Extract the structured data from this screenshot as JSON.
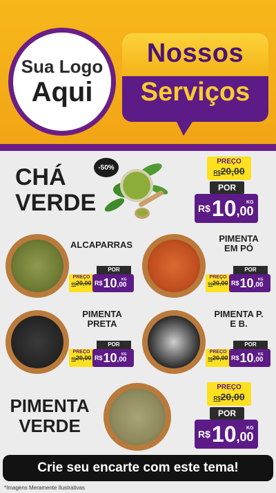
{
  "header": {
    "logo_line1": "Sua Logo",
    "logo_line2": "Aqui",
    "title_line1": "Nossos",
    "title_line2": "Serviços"
  },
  "featured": [
    {
      "name_line1": "CHÁ",
      "name_line2": "VERDE",
      "discount_badge": "-50%",
      "old_label": "PREÇO",
      "old_currency": "R$",
      "old_price": "20,00",
      "por_label": "POR",
      "currency": "R$",
      "price_int": "10",
      "price_dec": ",00",
      "unit": "KG"
    },
    {
      "name_line1": "PIMENTA",
      "name_line2": "VERDE",
      "old_label": "PREÇO",
      "old_currency": "R$",
      "old_price": "20,00",
      "por_label": "POR",
      "currency": "R$",
      "price_int": "10",
      "price_dec": ",00",
      "unit": "KG"
    }
  ],
  "products": [
    {
      "name_line1": "ALCAPARRAS",
      "name_line2": "",
      "old_label": "PREÇO",
      "old_currency": "R$",
      "old_price": "20,00",
      "por_label": "POR",
      "currency": "R$",
      "price_int": "10",
      "price_dec": ",00",
      "unit": "KG"
    },
    {
      "name_line1": "PIMENTA",
      "name_line2": "EM PÓ",
      "old_label": "PREÇO",
      "old_currency": "R$",
      "old_price": "20,00",
      "por_label": "POR",
      "currency": "R$",
      "price_int": "10",
      "price_dec": ",00",
      "unit": "KG"
    },
    {
      "name_line1": "PIMENTA",
      "name_line2": "PRETA",
      "old_label": "PREÇO",
      "old_currency": "R$",
      "old_price": "20,00",
      "por_label": "POR",
      "currency": "R$",
      "price_int": "10",
      "price_dec": ",00",
      "unit": "KG"
    },
    {
      "name_line1": "PIMENTA P.",
      "name_line2": "E B.",
      "old_label": "PREÇO",
      "old_currency": "R$",
      "old_price": "20,00",
      "por_label": "POR",
      "currency": "R$",
      "price_int": "10",
      "price_dec": ",00",
      "unit": "KG"
    }
  ],
  "footer": {
    "cta": "Crie seu encarte com este tema!",
    "note": "*Imagens Meramente Ilustrativas"
  },
  "colors": {
    "header_yellow": "#f7b81b",
    "brand_purple": "#5c1b86",
    "tag_yellow": "#fde01f",
    "tag_black": "#2b2b2b"
  }
}
